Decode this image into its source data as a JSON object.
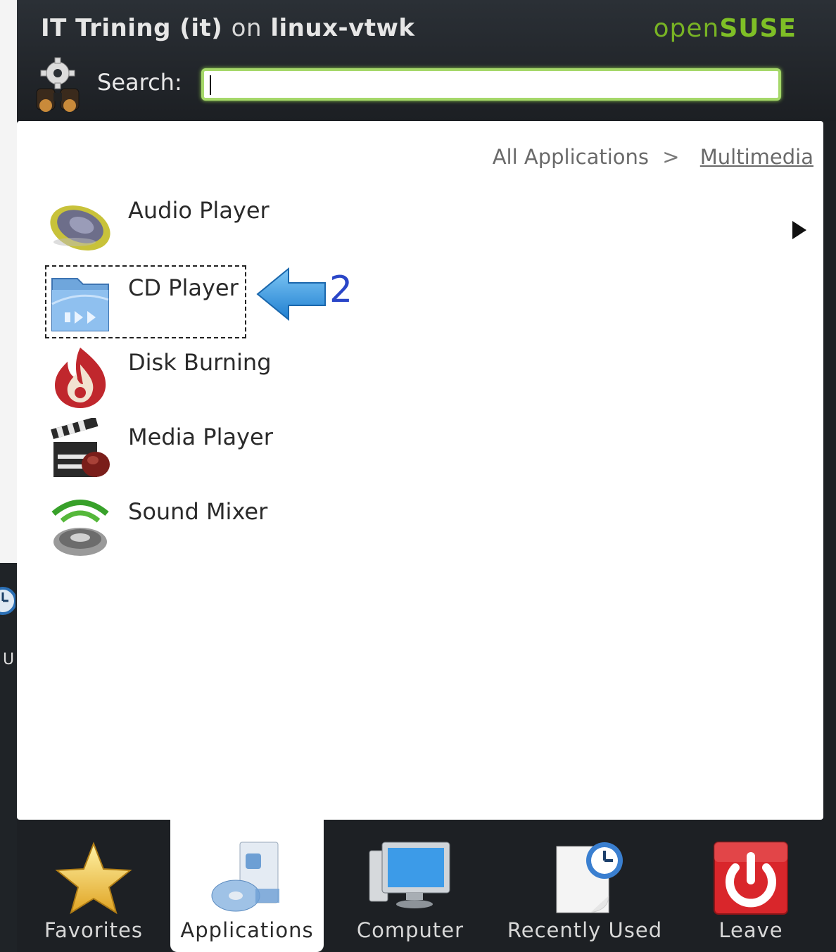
{
  "window": {
    "title_user": "IT Trining (it)",
    "title_on": "on",
    "title_host": "linux-vtwk",
    "brand_open": "open",
    "brand_suse": "SUSE"
  },
  "search": {
    "label": "Search:",
    "value": "",
    "placeholder": ""
  },
  "breadcrumb": {
    "root": "All Applications",
    "separator": ">",
    "current": "Multimedia"
  },
  "apps": [
    {
      "label": "Audio Player",
      "icon": "speaker-icon"
    },
    {
      "label": "CD Player",
      "icon": "cd-player-icon"
    },
    {
      "label": "Disk Burning",
      "icon": "disk-burning-icon"
    },
    {
      "label": "Media Player",
      "icon": "clapperboard-icon"
    },
    {
      "label": "Sound Mixer",
      "icon": "sound-mixer-icon"
    }
  ],
  "annotation": {
    "number": "2"
  },
  "desktop_peek": {
    "label": "U"
  },
  "tabs": [
    {
      "label": "Favorites",
      "icon": "star-icon",
      "active": false
    },
    {
      "label": "Applications",
      "icon": "applications-icon",
      "active": true
    },
    {
      "label": "Computer",
      "icon": "computer-icon",
      "active": false
    },
    {
      "label": "Recently Used",
      "icon": "recent-document-icon",
      "active": false
    },
    {
      "label": "Leave",
      "icon": "power-icon",
      "active": false
    }
  ],
  "colors": {
    "accent_green": "#7fbf26",
    "search_border": "#a6d86a",
    "annotation_blue": "#2a46c8",
    "panel_dark": "#1d2024"
  }
}
